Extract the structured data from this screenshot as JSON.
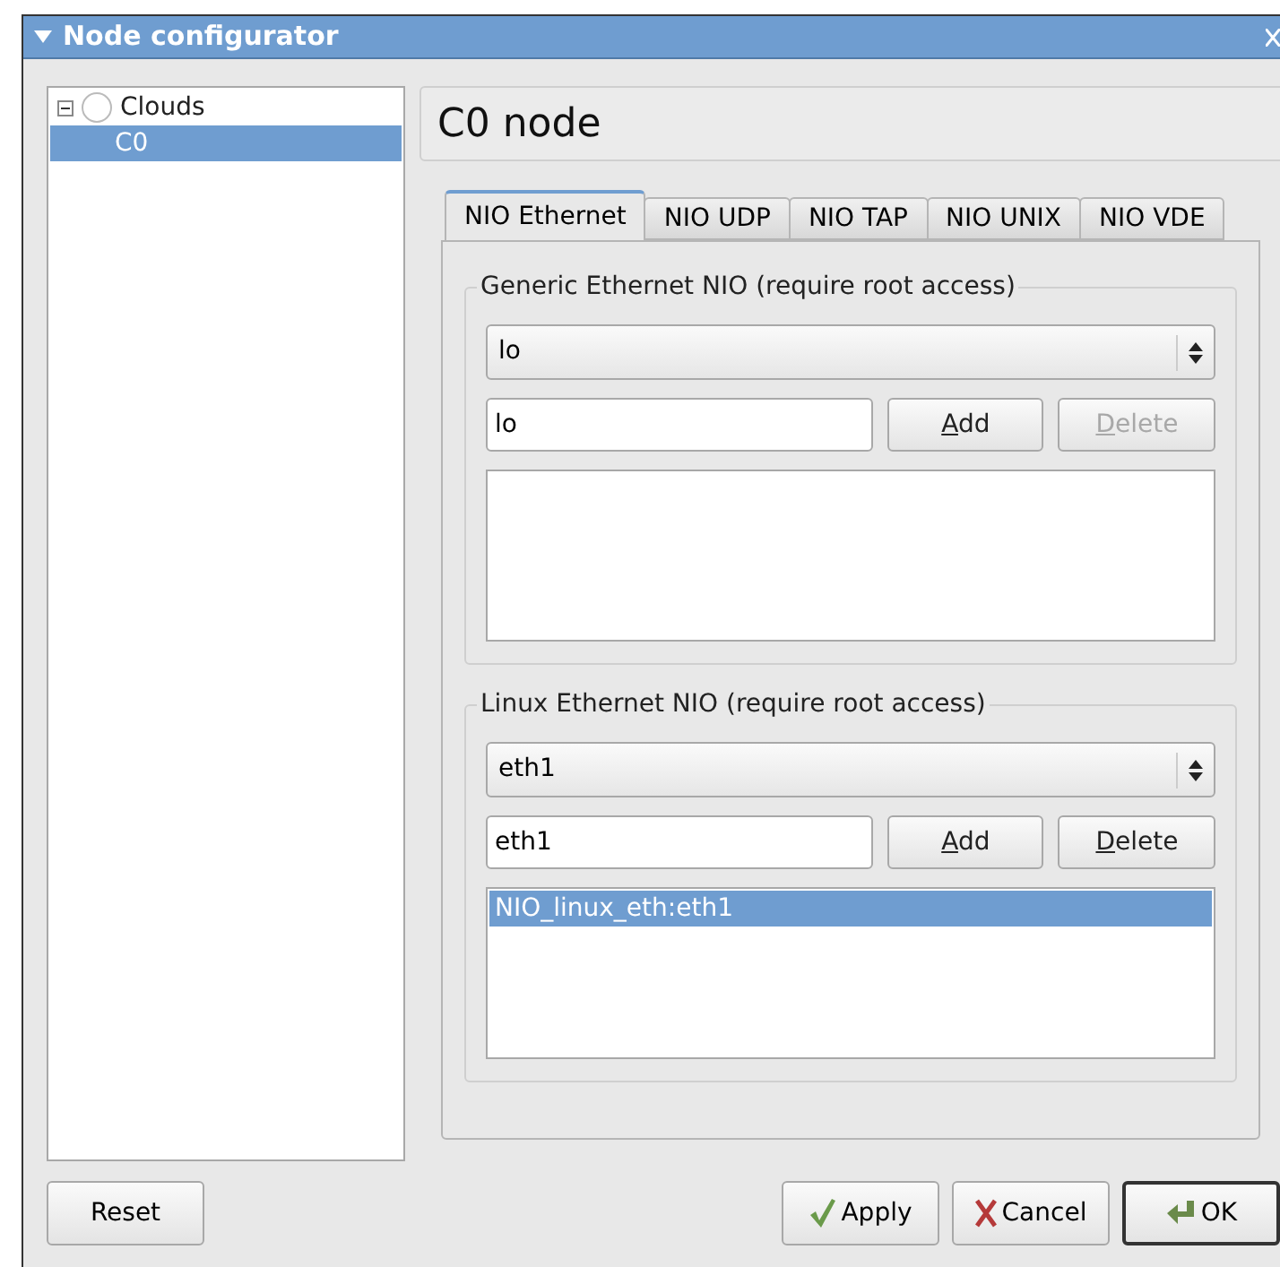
{
  "window": {
    "title": "Node configurator"
  },
  "tree": [
    {
      "label": "Clouds",
      "expanded": true,
      "selected": false,
      "children": [
        {
          "label": "C0",
          "selected": true
        }
      ]
    }
  ],
  "header": {
    "title": "C0 node"
  },
  "tabs": [
    {
      "label": "NIO Ethernet",
      "selected": true
    },
    {
      "label": "NIO UDP",
      "selected": false
    },
    {
      "label": "NIO TAP",
      "selected": false
    },
    {
      "label": "NIO UNIX",
      "selected": false
    },
    {
      "label": "NIO VDE",
      "selected": false
    }
  ],
  "groups": [
    {
      "title": "Generic Ethernet NIO (require root access)",
      "dropdown": "lo",
      "input": "lo",
      "add": {
        "label": "Add",
        "disabled": false
      },
      "delete": {
        "label": "Delete",
        "disabled": true
      }
    },
    {
      "title": "Linux Ethernet NIO (require root access)",
      "dropdown": "eth1",
      "input": "eth1",
      "add": {
        "label": "Add",
        "disabled": false
      },
      "delete": {
        "label": "Delete",
        "disabled": false
      },
      "items": [
        {
          "label": "NIO_linux_eth:eth1",
          "selected": true
        }
      ]
    }
  ],
  "buttons": {
    "reset": "Reset",
    "apply": "Apply",
    "cancel": "Cancel",
    "ok": "OK"
  }
}
